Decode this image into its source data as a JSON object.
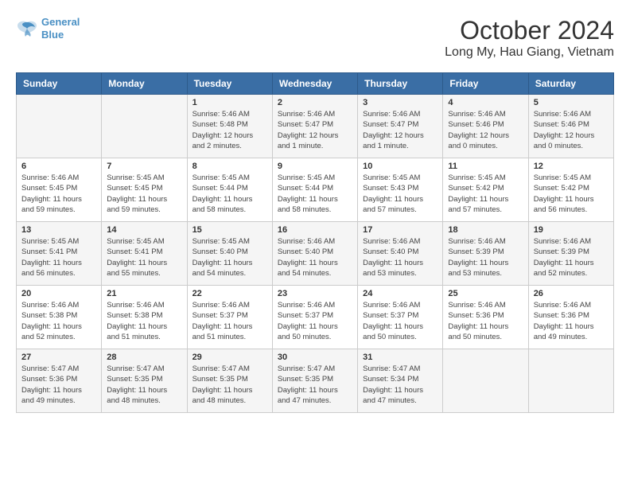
{
  "header": {
    "logo_line1": "General",
    "logo_line2": "Blue",
    "month_title": "October 2024",
    "location": "Long My, Hau Giang, Vietnam"
  },
  "days_of_week": [
    "Sunday",
    "Monday",
    "Tuesday",
    "Wednesday",
    "Thursday",
    "Friday",
    "Saturday"
  ],
  "weeks": [
    [
      {
        "day": "",
        "info": ""
      },
      {
        "day": "",
        "info": ""
      },
      {
        "day": "1",
        "info": "Sunrise: 5:46 AM\nSunset: 5:48 PM\nDaylight: 12 hours\nand 2 minutes."
      },
      {
        "day": "2",
        "info": "Sunrise: 5:46 AM\nSunset: 5:47 PM\nDaylight: 12 hours\nand 1 minute."
      },
      {
        "day": "3",
        "info": "Sunrise: 5:46 AM\nSunset: 5:47 PM\nDaylight: 12 hours\nand 1 minute."
      },
      {
        "day": "4",
        "info": "Sunrise: 5:46 AM\nSunset: 5:46 PM\nDaylight: 12 hours\nand 0 minutes."
      },
      {
        "day": "5",
        "info": "Sunrise: 5:46 AM\nSunset: 5:46 PM\nDaylight: 12 hours\nand 0 minutes."
      }
    ],
    [
      {
        "day": "6",
        "info": "Sunrise: 5:46 AM\nSunset: 5:45 PM\nDaylight: 11 hours\nand 59 minutes."
      },
      {
        "day": "7",
        "info": "Sunrise: 5:45 AM\nSunset: 5:45 PM\nDaylight: 11 hours\nand 59 minutes."
      },
      {
        "day": "8",
        "info": "Sunrise: 5:45 AM\nSunset: 5:44 PM\nDaylight: 11 hours\nand 58 minutes."
      },
      {
        "day": "9",
        "info": "Sunrise: 5:45 AM\nSunset: 5:44 PM\nDaylight: 11 hours\nand 58 minutes."
      },
      {
        "day": "10",
        "info": "Sunrise: 5:45 AM\nSunset: 5:43 PM\nDaylight: 11 hours\nand 57 minutes."
      },
      {
        "day": "11",
        "info": "Sunrise: 5:45 AM\nSunset: 5:42 PM\nDaylight: 11 hours\nand 57 minutes."
      },
      {
        "day": "12",
        "info": "Sunrise: 5:45 AM\nSunset: 5:42 PM\nDaylight: 11 hours\nand 56 minutes."
      }
    ],
    [
      {
        "day": "13",
        "info": "Sunrise: 5:45 AM\nSunset: 5:41 PM\nDaylight: 11 hours\nand 56 minutes."
      },
      {
        "day": "14",
        "info": "Sunrise: 5:45 AM\nSunset: 5:41 PM\nDaylight: 11 hours\nand 55 minutes."
      },
      {
        "day": "15",
        "info": "Sunrise: 5:45 AM\nSunset: 5:40 PM\nDaylight: 11 hours\nand 54 minutes."
      },
      {
        "day": "16",
        "info": "Sunrise: 5:46 AM\nSunset: 5:40 PM\nDaylight: 11 hours\nand 54 minutes."
      },
      {
        "day": "17",
        "info": "Sunrise: 5:46 AM\nSunset: 5:40 PM\nDaylight: 11 hours\nand 53 minutes."
      },
      {
        "day": "18",
        "info": "Sunrise: 5:46 AM\nSunset: 5:39 PM\nDaylight: 11 hours\nand 53 minutes."
      },
      {
        "day": "19",
        "info": "Sunrise: 5:46 AM\nSunset: 5:39 PM\nDaylight: 11 hours\nand 52 minutes."
      }
    ],
    [
      {
        "day": "20",
        "info": "Sunrise: 5:46 AM\nSunset: 5:38 PM\nDaylight: 11 hours\nand 52 minutes."
      },
      {
        "day": "21",
        "info": "Sunrise: 5:46 AM\nSunset: 5:38 PM\nDaylight: 11 hours\nand 51 minutes."
      },
      {
        "day": "22",
        "info": "Sunrise: 5:46 AM\nSunset: 5:37 PM\nDaylight: 11 hours\nand 51 minutes."
      },
      {
        "day": "23",
        "info": "Sunrise: 5:46 AM\nSunset: 5:37 PM\nDaylight: 11 hours\nand 50 minutes."
      },
      {
        "day": "24",
        "info": "Sunrise: 5:46 AM\nSunset: 5:37 PM\nDaylight: 11 hours\nand 50 minutes."
      },
      {
        "day": "25",
        "info": "Sunrise: 5:46 AM\nSunset: 5:36 PM\nDaylight: 11 hours\nand 50 minutes."
      },
      {
        "day": "26",
        "info": "Sunrise: 5:46 AM\nSunset: 5:36 PM\nDaylight: 11 hours\nand 49 minutes."
      }
    ],
    [
      {
        "day": "27",
        "info": "Sunrise: 5:47 AM\nSunset: 5:36 PM\nDaylight: 11 hours\nand 49 minutes."
      },
      {
        "day": "28",
        "info": "Sunrise: 5:47 AM\nSunset: 5:35 PM\nDaylight: 11 hours\nand 48 minutes."
      },
      {
        "day": "29",
        "info": "Sunrise: 5:47 AM\nSunset: 5:35 PM\nDaylight: 11 hours\nand 48 minutes."
      },
      {
        "day": "30",
        "info": "Sunrise: 5:47 AM\nSunset: 5:35 PM\nDaylight: 11 hours\nand 47 minutes."
      },
      {
        "day": "31",
        "info": "Sunrise: 5:47 AM\nSunset: 5:34 PM\nDaylight: 11 hours\nand 47 minutes."
      },
      {
        "day": "",
        "info": ""
      },
      {
        "day": "",
        "info": ""
      }
    ]
  ]
}
